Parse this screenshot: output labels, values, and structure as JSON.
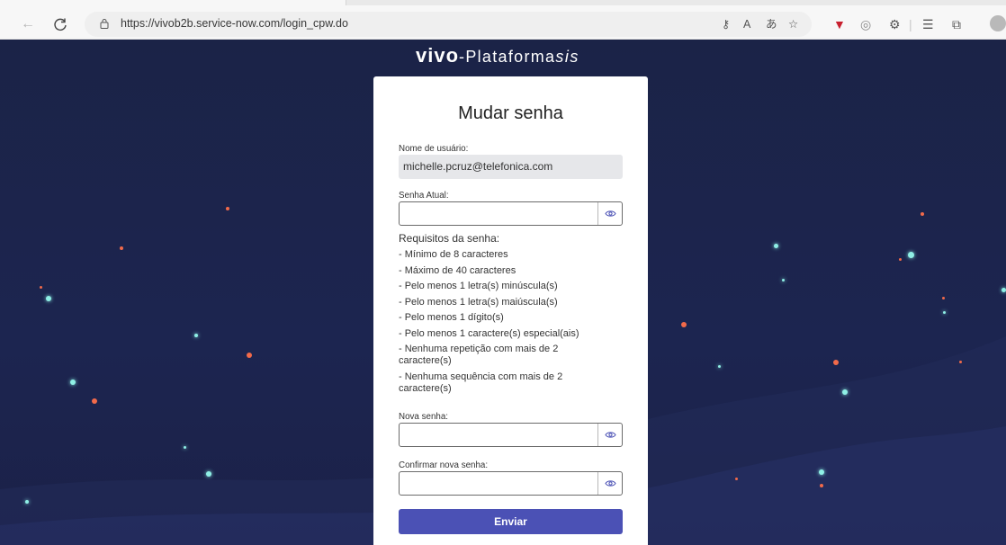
{
  "browser": {
    "url": "https://vivob2b.service-now.com/login_cpw.do",
    "back_icon": "←",
    "reload_icon": "C"
  },
  "brand": {
    "vivo": "vivo",
    "platform": "-Plataforma",
    "sis": "sis"
  },
  "form": {
    "title": "Mudar senha",
    "username_label": "Nome de usuário:",
    "username_value": "michelle.pcruz@telefonica.com",
    "current_password_label": "Senha Atual:",
    "requirements_title": "Requisitos da senha:",
    "requirements": [
      "- Mínimo de 8 caracteres",
      "- Máximo de 40 caracteres",
      "- Pelo menos 1 letra(s) minúscula(s)",
      "- Pelo menos 1 letra(s) maiúscula(s)",
      "- Pelo menos 1 dígito(s)",
      "- Pelo menos 1 caractere(s) especial(ais)",
      "- Nenhuma repetição com mais de 2 caractere(s)",
      "- Nenhuma sequência com mais de 2 caractere(s)"
    ],
    "new_password_label": "Nova senha:",
    "confirm_password_label": "Confirmar nova senha:",
    "submit_label": "Enviar"
  },
  "colors": {
    "background": "#1b2347",
    "accent": "#4b51b5",
    "dot_orange": "#f26a4a",
    "dot_cyan": "#8ff0e6"
  }
}
